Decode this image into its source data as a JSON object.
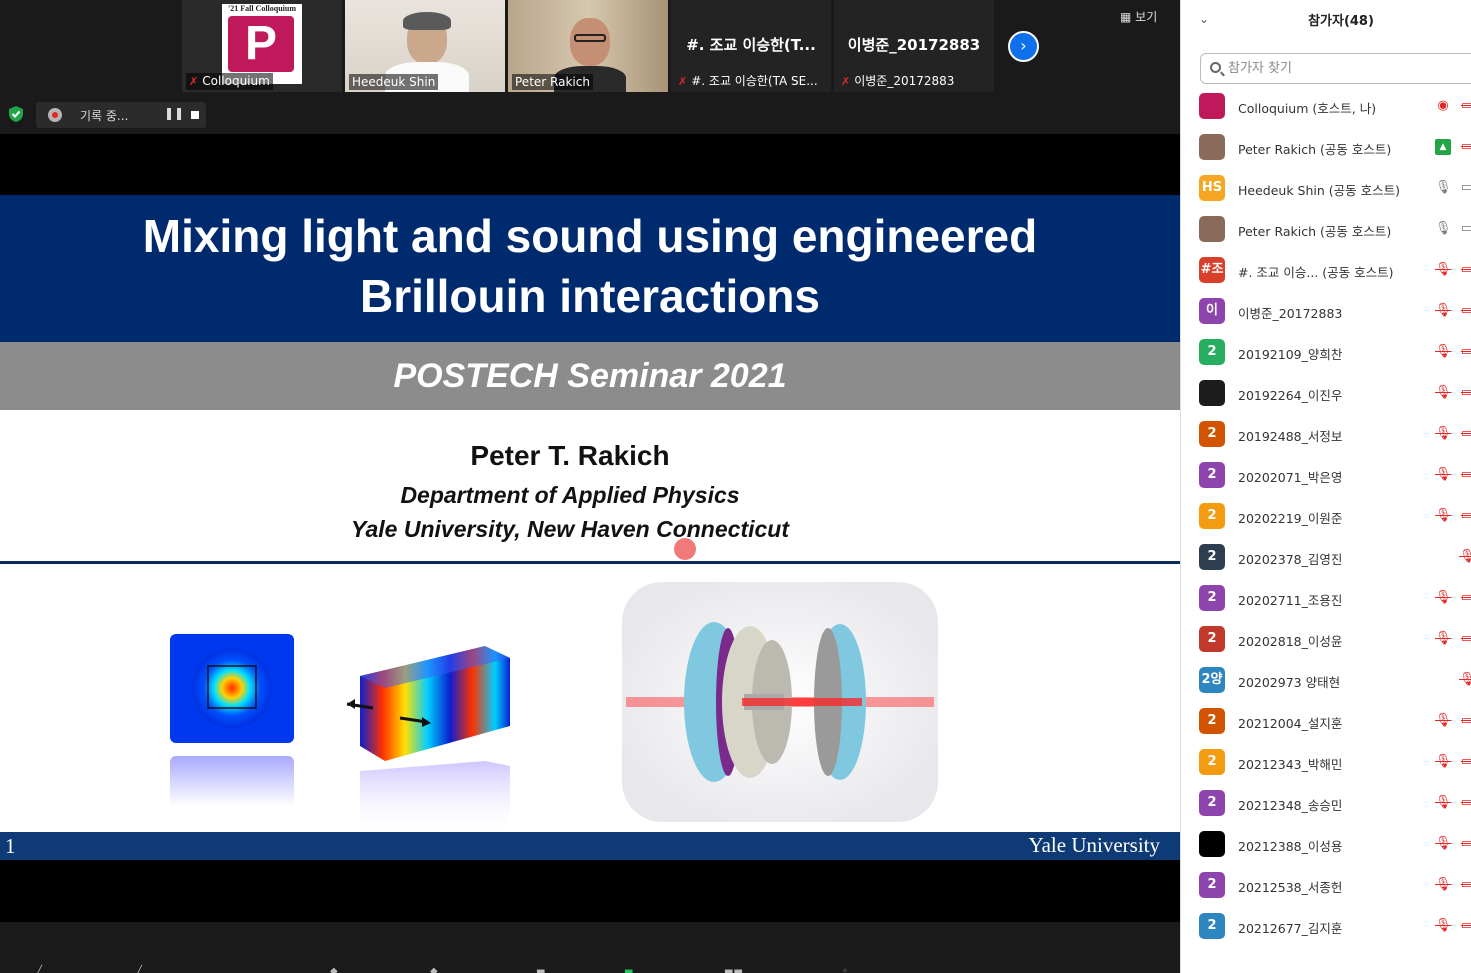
{
  "video_strip": {
    "tiles": [
      {
        "name": "Colloquium",
        "muted": true,
        "badge": "'21 Fall Colloquium"
      },
      {
        "name": "Heedeuk Shin",
        "muted": false
      },
      {
        "name": "Peter Rakich",
        "muted": false,
        "active": true
      },
      {
        "name": "#. 조교 이승한(TA SE...",
        "big_name": "#. 조교 이승한(T...",
        "muted": true
      },
      {
        "name": "이병준_20172883",
        "big_name": "이병준_20172883",
        "muted": true
      }
    ],
    "next_icon": "chevron-right-icon",
    "view_label": "보기"
  },
  "recording": {
    "label": "기록 중..."
  },
  "slide": {
    "title_line1": "Mixing light and sound using engineered",
    "title_line2": "Brillouin interactions",
    "subtitle": "POSTECH  Seminar 2021",
    "author": "Peter T. Rakich",
    "department": "Department of Applied Physics",
    "university": "Yale University, New Haven Connecticut",
    "slide_number": "1",
    "footer": "Yale University",
    "colors": {
      "title_band": "#002a6e",
      "subtitle_band": "#8c8c8c",
      "footer_band": "#0e3b75"
    }
  },
  "panel": {
    "title": "참가자(48)",
    "search_placeholder": "참가자 찾기",
    "participants": [
      {
        "name": "Colloquium (호스트, 나)",
        "avatar": "",
        "avatar_color": "#c0195b",
        "icon1": "record",
        "icon2": "video-off"
      },
      {
        "name": "Peter Rakich (공동 호스트)",
        "avatar": "",
        "avatar_color": "#8a6a5a",
        "icon1": "share",
        "icon2": "video-off"
      },
      {
        "name": "Heedeuk Shin (공동 호스트)",
        "avatar": "HS",
        "avatar_color": "#f5a623",
        "icon1": "mic",
        "icon2": "video"
      },
      {
        "name": "Peter Rakich (공동 호스트)",
        "avatar": "",
        "avatar_color": "#8a6a5a",
        "icon1": "mic",
        "icon2": "video"
      },
      {
        "name": "#. 조교 이승...  (공동 호스트)",
        "avatar": "#조",
        "avatar_color": "#d9402b",
        "icon1": "mic-off",
        "icon2": "video-off"
      },
      {
        "name": " 이병준_20172883",
        "avatar": "이",
        "avatar_color": "#8e44ad",
        "icon1": "mic-off",
        "icon2": "video-off"
      },
      {
        "name": "20192109_양희찬",
        "avatar": "2",
        "avatar_color": "#27ae60",
        "icon1": "mic-off",
        "icon2": "video-off"
      },
      {
        "name": "20192264_이진우",
        "avatar": "",
        "avatar_color": "#1c1c1c",
        "icon1": "mic-off",
        "icon2": "video-off"
      },
      {
        "name": "20192488_서정보",
        "avatar": "2",
        "avatar_color": "#d35400",
        "icon1": "mic-off",
        "icon2": "video-off"
      },
      {
        "name": "20202071_박은영",
        "avatar": "2",
        "avatar_color": "#8e44ad",
        "icon1": "mic-off",
        "icon2": "video-off"
      },
      {
        "name": "20202219_이원준",
        "avatar": "2",
        "avatar_color": "#f39c12",
        "icon1": "mic-off",
        "icon2": "video-off"
      },
      {
        "name": "20202378_김영진",
        "avatar": "2",
        "avatar_color": "#2c3e50",
        "icon1": "",
        "icon2": "mic-off"
      },
      {
        "name": "20202711_조용진",
        "avatar": "2",
        "avatar_color": "#8e44ad",
        "icon1": "mic-off",
        "icon2": "video-off"
      },
      {
        "name": "20202818_이성윤",
        "avatar": "2",
        "avatar_color": "#c0392b",
        "icon1": "mic-off",
        "icon2": "video-off"
      },
      {
        "name": "20202973 양태현",
        "avatar": "2양",
        "avatar_color": "#2e86c1",
        "icon1": "",
        "icon2": "mic-off"
      },
      {
        "name": "20212004_설지훈",
        "avatar": "2",
        "avatar_color": "#d35400",
        "icon1": "mic-off",
        "icon2": "video-off"
      },
      {
        "name": "20212343_박해민",
        "avatar": "2",
        "avatar_color": "#f39c12",
        "icon1": "mic-off",
        "icon2": "video-off"
      },
      {
        "name": "20212348_송승민",
        "avatar": "2",
        "avatar_color": "#8e44ad",
        "icon1": "mic-off",
        "icon2": "video-off"
      },
      {
        "name": "20212388_이성용",
        "avatar": "",
        "avatar_color": "#000000",
        "icon1": "mic-off",
        "icon2": "video-off"
      },
      {
        "name": "20212538_서종헌",
        "avatar": "2",
        "avatar_color": "#8e44ad",
        "icon1": "mic-off",
        "icon2": "video-off"
      },
      {
        "name": "20212677_김지훈",
        "avatar": "2",
        "avatar_color": "#2e86c1",
        "icon1": "mic-off",
        "icon2": "video-off"
      }
    ]
  }
}
